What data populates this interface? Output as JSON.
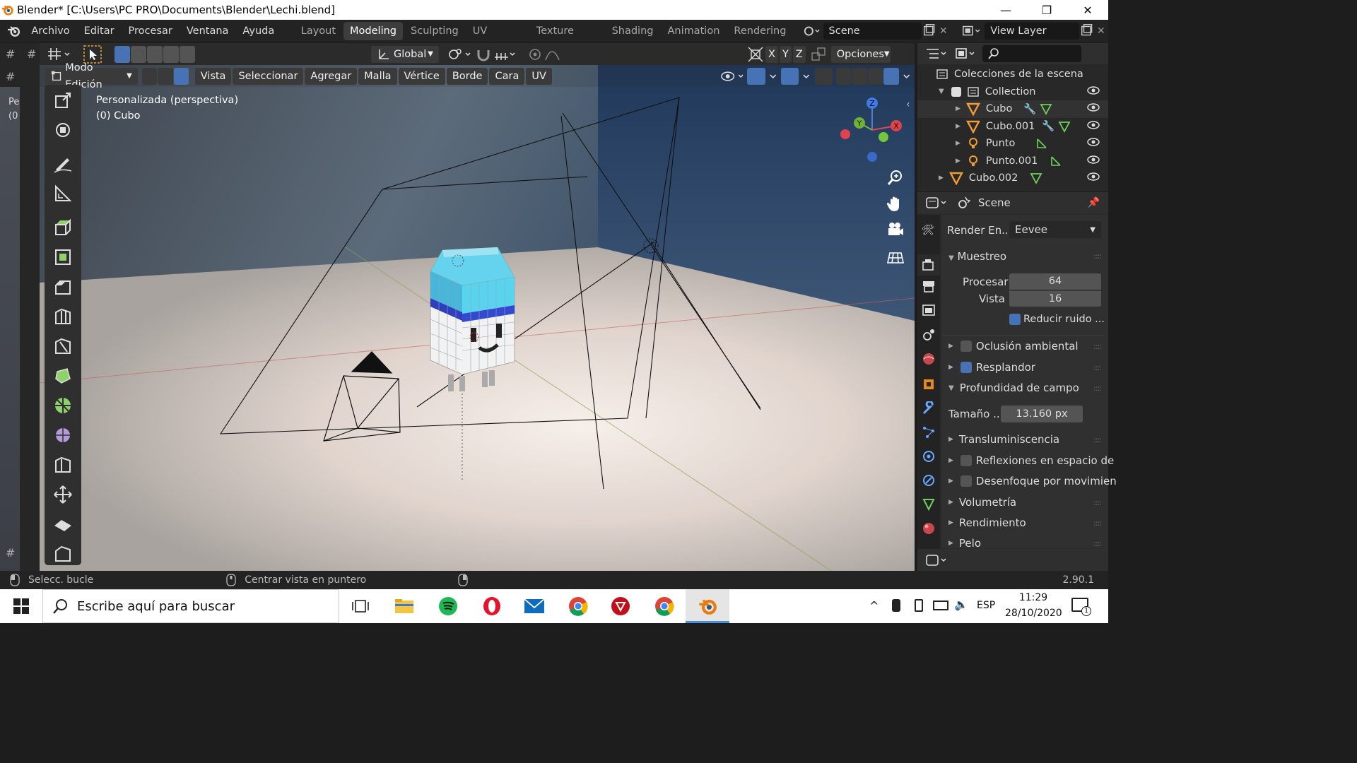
{
  "window": {
    "title": "Blender* [C:\\Users\\PC PRO\\Documents\\Blender\\Lechi.blend]",
    "minimize": "—",
    "restore": "❐",
    "close": "✕"
  },
  "menus": [
    "Archivo",
    "Editar",
    "Procesar",
    "Ventana",
    "Ayuda"
  ],
  "workspaces": [
    "Layout",
    "Modeling",
    "Sculpting",
    "UV Editing",
    "Texture Paint",
    "Shading",
    "Animation",
    "Rendering"
  ],
  "active_workspace": "Modeling",
  "scene_name": "Scene",
  "view_layer": "View Layer",
  "header1": {
    "transform_orientation": "Global",
    "axes": [
      "X",
      "Y",
      "Z"
    ],
    "options": "Opciones"
  },
  "header2": {
    "mode": "Modo Edición",
    "menus": [
      "Vista",
      "Seleccionar",
      "Agregar",
      "Malla",
      "Vértice",
      "Borde",
      "Cara",
      "UV"
    ]
  },
  "viewport": {
    "view_name": "Personalizada (perspectiva)",
    "object_name": "(0) Cubo",
    "gizmo_axes": [
      "X",
      "Y",
      "Z"
    ]
  },
  "left_strip": {
    "labels": [
      "Pe",
      "(0"
    ]
  },
  "outliner": {
    "root": "Colecciones de la escena",
    "items": [
      {
        "name": "Collection",
        "depth": 1,
        "icon": "collection-icon"
      },
      {
        "name": "Cubo",
        "depth": 2,
        "icon": "mesh-icon"
      },
      {
        "name": "Cubo.001",
        "depth": 2,
        "icon": "mesh-icon"
      },
      {
        "name": "Punto",
        "depth": 2,
        "icon": "light-icon"
      },
      {
        "name": "Punto.001",
        "depth": 2,
        "icon": "light-icon"
      },
      {
        "name": "Cubo.002",
        "depth": 1,
        "icon": "mesh-icon"
      }
    ]
  },
  "properties": {
    "context": "Scene",
    "render_engine_label": "Render En...",
    "render_engine": "Eevee",
    "sampling_title": "Muestreo",
    "render_label": "Procesar",
    "render_value": "64",
    "viewport_label": "Vista",
    "viewport_value": "16",
    "denoise_label": "Reducir ruido ...",
    "ao_label": "Oclusión ambiental",
    "bloom_label": "Resplandor",
    "dof_title": "Profundidad de campo",
    "size_label": "Tamaño ...",
    "size_value": "13.160 px",
    "sss_label": "Transluminiscencia",
    "ssr_label": "Reflexiones en espacio de",
    "motion_blur_label": "Desenfoque por movimien",
    "volumetrics_label": "Volumetría",
    "performance_label": "Rendimiento",
    "hair_label": "Pelo"
  },
  "statusbar": {
    "left": "Selecc. bucle",
    "middle": "Centrar vista en puntero",
    "version": "2.90.1"
  },
  "taskbar": {
    "search_placeholder": "Escribe aquí para buscar",
    "language": "ESP",
    "time": "11:29",
    "date": "28/10/2020",
    "notifications": "1"
  },
  "colors": {
    "accent": "#4772b3",
    "active_tab": "#3d3d3d",
    "panel": "#2b2b2b"
  }
}
